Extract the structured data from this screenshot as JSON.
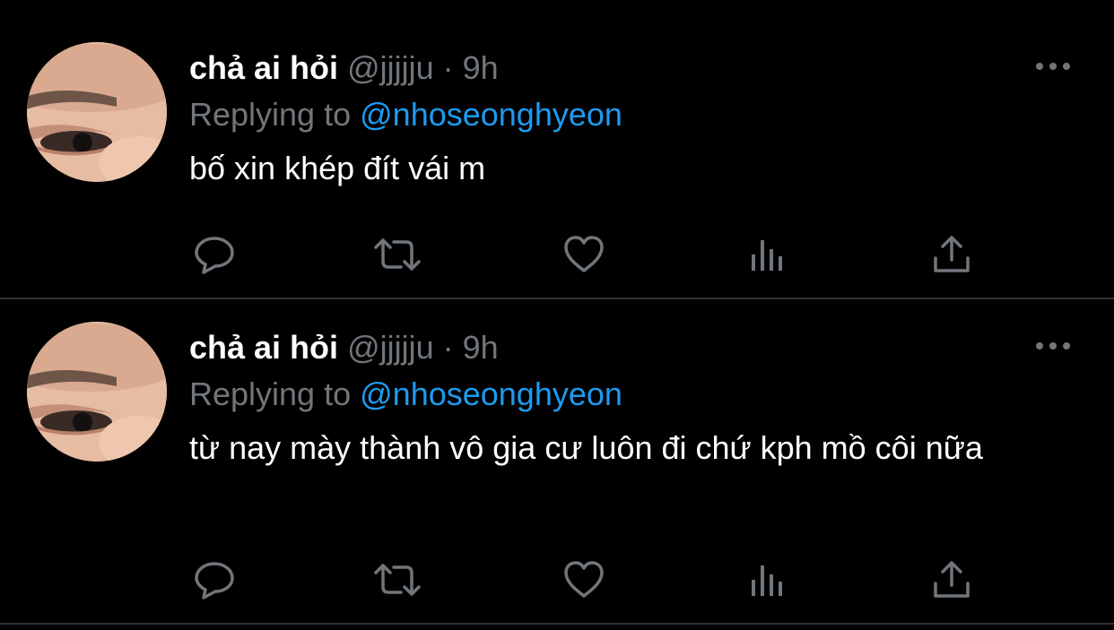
{
  "colors": {
    "background": "#000000",
    "text_primary": "#ffffff",
    "text_secondary": "#71767b",
    "mention": "#1d9bf0",
    "divider": "#2f3336",
    "icon": "#71767b"
  },
  "tweets": [
    {
      "display_name": "chả ai hỏi",
      "handle": "@jjjjju",
      "separator": "·",
      "time": "9h",
      "replying_prefix": "Replying to",
      "replying_to": "@nhoseonghyeon",
      "text": "bố xin khép đít vái m",
      "actions": [
        "reply-icon",
        "retweet-icon",
        "like-icon",
        "views-icon",
        "share-icon"
      ],
      "more_icon": "more-icon"
    },
    {
      "display_name": "chả ai hỏi",
      "handle": "@jjjjju",
      "separator": "·",
      "time": "9h",
      "replying_prefix": "Replying to",
      "replying_to": "@nhoseonghyeon",
      "text": "từ nay mày thành vô gia cư luôn đi chứ kph mồ côi nữa",
      "actions": [
        "reply-icon",
        "retweet-icon",
        "like-icon",
        "views-icon",
        "share-icon"
      ],
      "more_icon": "more-icon"
    }
  ]
}
